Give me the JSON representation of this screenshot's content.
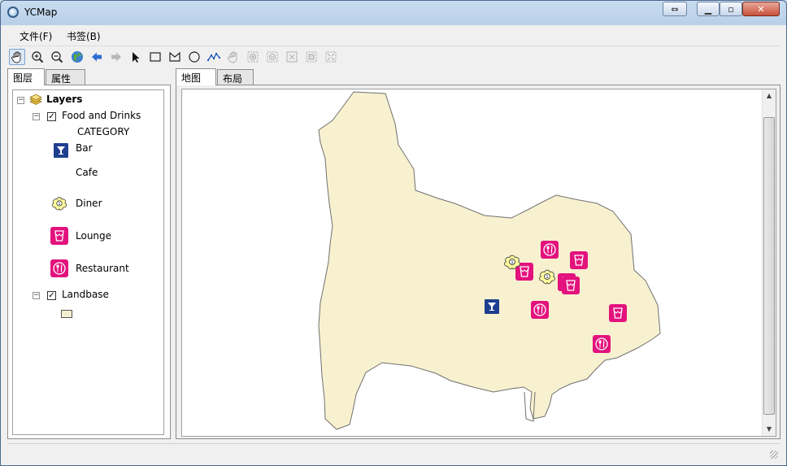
{
  "window": {
    "title": "YCMap"
  },
  "menu": [
    {
      "label": "文件(F)"
    },
    {
      "label": "书签(B)"
    }
  ],
  "toolbar_icons": [
    "pan-hand-icon",
    "zoom-in-icon",
    "zoom-out-icon",
    "full-extent-globe-icon",
    "back-arrow-icon",
    "forward-arrow-icon",
    "select-pointer-icon",
    "rectangle-icon",
    "polygon-icon",
    "circle-icon",
    "polyline-icon",
    "pan-disabled-icon",
    "fixed-zoom-in-icon",
    "fixed-zoom-out-icon",
    "zoom-layer-icon",
    "zoom-selected-icon"
  ],
  "left_tabs": [
    {
      "label": "图层"
    },
    {
      "label": "属性"
    }
  ],
  "map_tabs": [
    {
      "label": "地图"
    },
    {
      "label": "布局"
    }
  ],
  "tree": {
    "root": {
      "label": "Layers",
      "icon": "layers-stack-icon"
    },
    "food_layer": {
      "label": "Food and Drinks",
      "checked": true
    },
    "category_header": "CATEGORY",
    "categories": [
      {
        "label": "Bar",
        "icon": "cocktail-icon",
        "color": "#1f3f8f"
      },
      {
        "label": "Cafe",
        "icon": "",
        "color": ""
      },
      {
        "label": "Diner",
        "icon": "diner-cloud-icon",
        "color": "#fffb9a"
      },
      {
        "label": "Lounge",
        "icon": "lounge-glass-icon",
        "color": "#e3127d"
      },
      {
        "label": "Restaurant",
        "icon": "fork-knife-icon",
        "color": "#e3127d"
      }
    ],
    "land_layer": {
      "label": "Landbase",
      "checked": true,
      "fill": "#f5efcf"
    }
  },
  "colors": {
    "land_fill": "#f7f1d0",
    "land_outline": "#707070",
    "accent": "#e3127d",
    "bar_blue": "#1f3f8f",
    "diner_yellow": "#fffb9a"
  }
}
